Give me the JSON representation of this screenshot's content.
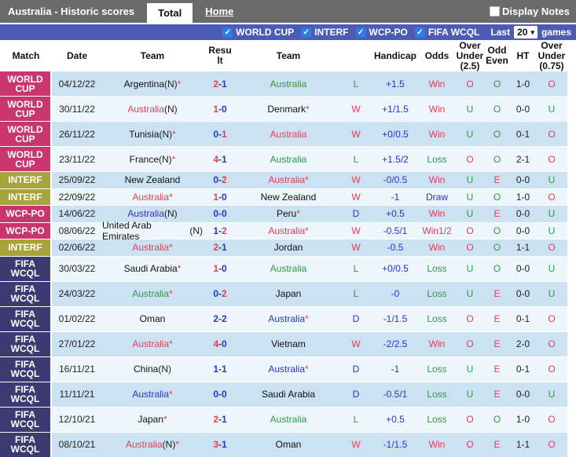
{
  "top_bar": {
    "title": "Australia - Historic scores",
    "tabs": [
      {
        "label": "Total",
        "active": true
      },
      {
        "label": "Home",
        "active": false
      }
    ],
    "display_notes_label": "Display Notes",
    "display_notes_checked": false
  },
  "filter_bar": {
    "competitions": [
      {
        "label": "WORLD CUP",
        "checked": true
      },
      {
        "label": "INTERF",
        "checked": true
      },
      {
        "label": "WCP-PO",
        "checked": true
      },
      {
        "label": "FIFA WCQL",
        "checked": true
      }
    ],
    "last_label": "Last",
    "games_count": "20",
    "games_label": "games",
    "checkmark": "✓",
    "caret": "▾"
  },
  "colors": {
    "win": "#ee3a56",
    "loss": "#2e9a40",
    "draw": "#2b35c5",
    "top_bar": "#6b6b6b",
    "filter_bar": "#4c5cb5",
    "checkbox_blue": "#2b7de3",
    "row_odd": "#cbe2f2",
    "row_even": "#edf6fb",
    "comp": {
      "WORLD CUP": "#c9356d",
      "INTERF": "#a8a33c",
      "WCP-PO": "#c9356d",
      "FIFA WCQL": "#3b3a71"
    }
  },
  "table": {
    "headers": {
      "match": "Match",
      "date": "Date",
      "team1": "Team",
      "result": "Result",
      "team2": "Team",
      "handicap": "Handicap",
      "odds": "Odds",
      "ou25": "Over Under (2.5)",
      "oddeven": "Odd Even",
      "ht": "HT",
      "ou075": "Over Under (0.75)"
    },
    "rows": [
      {
        "comp": "WORLD CUP",
        "date": "04/12/22",
        "team1": {
          "name": "Argentina",
          "n": "(N)",
          "star": "*",
          "res": ""
        },
        "score": [
          2,
          1
        ],
        "team2": {
          "name": "Australia",
          "n": "",
          "star": "",
          "res": "loss"
        },
        "letter": "L",
        "handicap": "+1.5",
        "odds": "Win",
        "ou25": "O",
        "oddeven": "O",
        "ht": "1-0",
        "ou075": "O"
      },
      {
        "comp": "WORLD CUP",
        "date": "30/11/22",
        "team1": {
          "name": "Australia",
          "n": "(N)",
          "star": "",
          "res": "win"
        },
        "score": [
          1,
          0
        ],
        "team2": {
          "name": "Denmark",
          "n": "",
          "star": "*",
          "res": ""
        },
        "letter": "W",
        "handicap": "+1/1.5",
        "odds": "Win",
        "ou25": "U",
        "oddeven": "O",
        "ht": "0-0",
        "ou075": "U"
      },
      {
        "comp": "WORLD CUP",
        "date": "26/11/22",
        "team1": {
          "name": "Tunisia",
          "n": "(N)",
          "star": "*",
          "res": ""
        },
        "score": [
          0,
          1
        ],
        "team2": {
          "name": "Australia",
          "n": "",
          "star": "",
          "res": "win"
        },
        "letter": "W",
        "handicap": "+0/0.5",
        "odds": "Win",
        "ou25": "U",
        "oddeven": "O",
        "ht": "0-1",
        "ou075": "O"
      },
      {
        "comp": "WORLD CUP",
        "date": "23/11/22",
        "team1": {
          "name": "France",
          "n": "(N)",
          "star": "*",
          "res": ""
        },
        "score": [
          4,
          1
        ],
        "team2": {
          "name": "Australia",
          "n": "",
          "star": "",
          "res": "loss"
        },
        "letter": "L",
        "handicap": "+1.5/2",
        "odds": "Loss",
        "ou25": "O",
        "oddeven": "O",
        "ht": "2-1",
        "ou075": "O"
      },
      {
        "comp": "INTERF",
        "date": "25/09/22",
        "team1": {
          "name": "New Zealand",
          "n": "",
          "star": "",
          "res": ""
        },
        "score": [
          0,
          2
        ],
        "team2": {
          "name": "Australia",
          "n": "",
          "star": "*",
          "res": "win"
        },
        "letter": "W",
        "handicap": "-0/0.5",
        "odds": "Win",
        "ou25": "U",
        "oddeven": "E",
        "ht": "0-0",
        "ou075": "U"
      },
      {
        "comp": "INTERF",
        "date": "22/09/22",
        "team1": {
          "name": "Australia",
          "n": "",
          "star": "*",
          "res": "win"
        },
        "score": [
          1,
          0
        ],
        "team2": {
          "name": "New Zealand",
          "n": "",
          "star": "",
          "res": ""
        },
        "letter": "W",
        "handicap": "-1",
        "odds": "Draw",
        "ou25": "U",
        "oddeven": "O",
        "ht": "1-0",
        "ou075": "O"
      },
      {
        "comp": "WCP-PO",
        "date": "14/06/22",
        "team1": {
          "name": "Australia",
          "n": "(N)",
          "star": "",
          "res": "draw"
        },
        "score": [
          0,
          0
        ],
        "team2": {
          "name": "Peru",
          "n": "",
          "star": "*",
          "res": ""
        },
        "letter": "D",
        "handicap": "+0.5",
        "odds": "Win",
        "ou25": "U",
        "oddeven": "E",
        "ht": "0-0",
        "ou075": "U"
      },
      {
        "comp": "WCP-PO",
        "date": "08/06/22",
        "team1": {
          "name": "United Arab Emirates",
          "n": "(N)",
          "star": "",
          "res": ""
        },
        "score": [
          1,
          2
        ],
        "team2": {
          "name": "Australia",
          "n": "",
          "star": "*",
          "res": "win"
        },
        "letter": "W",
        "handicap": "-0.5/1",
        "odds": "Win1/2",
        "ou25": "O",
        "oddeven": "O",
        "ht": "0-0",
        "ou075": "U"
      },
      {
        "comp": "INTERF",
        "date": "02/06/22",
        "team1": {
          "name": "Australia",
          "n": "",
          "star": "*",
          "res": "win"
        },
        "score": [
          2,
          1
        ],
        "team2": {
          "name": "Jordan",
          "n": "",
          "star": "",
          "res": ""
        },
        "letter": "W",
        "handicap": "-0.5",
        "odds": "Win",
        "ou25": "O",
        "oddeven": "O",
        "ht": "1-1",
        "ou075": "O"
      },
      {
        "comp": "FIFA WCQL",
        "date": "30/03/22",
        "team1": {
          "name": "Saudi Arabia",
          "n": "",
          "star": "*",
          "res": ""
        },
        "score": [
          1,
          0
        ],
        "team2": {
          "name": "Australia",
          "n": "",
          "star": "",
          "res": "loss"
        },
        "letter": "L",
        "handicap": "+0/0.5",
        "odds": "Loss",
        "ou25": "U",
        "oddeven": "O",
        "ht": "0-0",
        "ou075": "U"
      },
      {
        "comp": "FIFA WCQL",
        "date": "24/03/22",
        "team1": {
          "name": "Australia",
          "n": "",
          "star": "*",
          "res": "loss"
        },
        "score": [
          0,
          2
        ],
        "team2": {
          "name": "Japan",
          "n": "",
          "star": "",
          "res": ""
        },
        "letter": "L",
        "handicap": "-0",
        "odds": "Loss",
        "ou25": "U",
        "oddeven": "E",
        "ht": "0-0",
        "ou075": "U"
      },
      {
        "comp": "FIFA WCQL",
        "date": "01/02/22",
        "team1": {
          "name": "Oman",
          "n": "",
          "star": "",
          "res": ""
        },
        "score": [
          2,
          2
        ],
        "team2": {
          "name": "Australia",
          "n": "",
          "star": "*",
          "res": "draw"
        },
        "letter": "D",
        "handicap": "-1/1.5",
        "odds": "Loss",
        "ou25": "O",
        "oddeven": "E",
        "ht": "0-1",
        "ou075": "O"
      },
      {
        "comp": "FIFA WCQL",
        "date": "27/01/22",
        "team1": {
          "name": "Australia",
          "n": "",
          "star": "*",
          "res": "win"
        },
        "score": [
          4,
          0
        ],
        "team2": {
          "name": "Vietnam",
          "n": "",
          "star": "",
          "res": ""
        },
        "letter": "W",
        "handicap": "-2/2.5",
        "odds": "Win",
        "ou25": "O",
        "oddeven": "E",
        "ht": "2-0",
        "ou075": "O"
      },
      {
        "comp": "FIFA WCQL",
        "date": "16/11/21",
        "team1": {
          "name": "China",
          "n": "(N)",
          "star": "",
          "res": ""
        },
        "score": [
          1,
          1
        ],
        "team2": {
          "name": "Australia",
          "n": "",
          "star": "*",
          "res": "draw"
        },
        "letter": "D",
        "handicap": "-1",
        "odds": "Loss",
        "ou25": "U",
        "oddeven": "E",
        "ht": "0-1",
        "ou075": "O"
      },
      {
        "comp": "FIFA WCQL",
        "date": "11/11/21",
        "team1": {
          "name": "Australia",
          "n": "",
          "star": "*",
          "res": "draw"
        },
        "score": [
          0,
          0
        ],
        "team2": {
          "name": "Saudi Arabia",
          "n": "",
          "star": "",
          "res": ""
        },
        "letter": "D",
        "handicap": "-0.5/1",
        "odds": "Loss",
        "ou25": "U",
        "oddeven": "E",
        "ht": "0-0",
        "ou075": "U"
      },
      {
        "comp": "FIFA WCQL",
        "date": "12/10/21",
        "team1": {
          "name": "Japan",
          "n": "",
          "star": "*",
          "res": ""
        },
        "score": [
          2,
          1
        ],
        "team2": {
          "name": "Australia",
          "n": "",
          "star": "",
          "res": "loss"
        },
        "letter": "L",
        "handicap": "+0.5",
        "odds": "Loss",
        "ou25": "O",
        "oddeven": "O",
        "ht": "1-0",
        "ou075": "O"
      },
      {
        "comp": "FIFA WCQL",
        "date": "08/10/21",
        "team1": {
          "name": "Australia",
          "n": "(N)",
          "star": "*",
          "res": "win"
        },
        "score": [
          3,
          1
        ],
        "team2": {
          "name": "Oman",
          "n": "",
          "star": "",
          "res": ""
        },
        "letter": "W",
        "handicap": "-1/1.5",
        "odds": "Win",
        "ou25": "O",
        "oddeven": "E",
        "ht": "1-1",
        "ou075": "O"
      }
    ]
  }
}
